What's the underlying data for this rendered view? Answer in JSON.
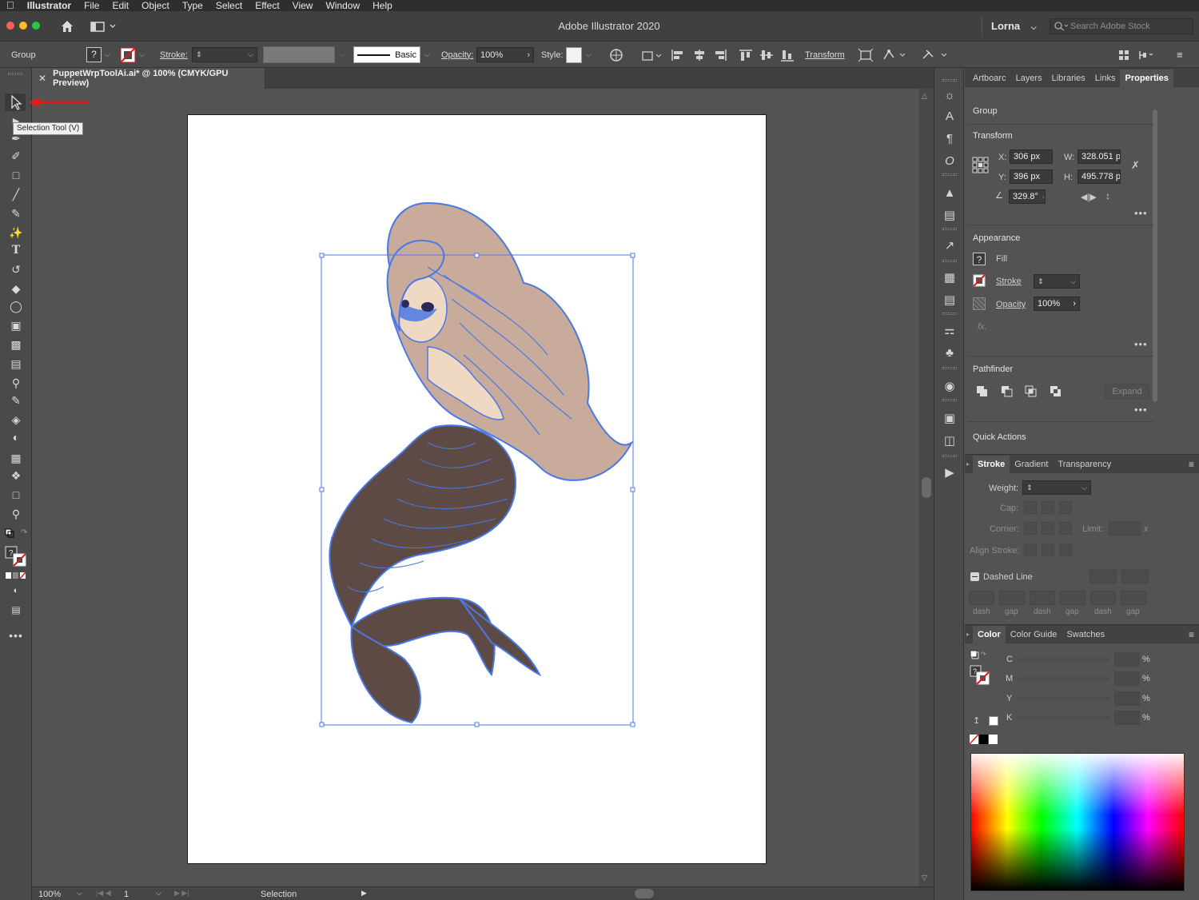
{
  "menubar": {
    "app": "Illustrator",
    "items": [
      "File",
      "Edit",
      "Object",
      "Type",
      "Select",
      "Effect",
      "View",
      "Window",
      "Help"
    ]
  },
  "titlebar": {
    "title": "Adobe Illustrator 2020",
    "user": "Lorna",
    "search_placeholder": "Search Adobe Stock"
  },
  "controlbar": {
    "selection_type": "Group",
    "stroke_label": "Stroke:",
    "brush_label": "Basic",
    "opacity_label": "Opacity:",
    "opacity_value": "100%",
    "style_label": "Style:",
    "transform_label": "Transform"
  },
  "document": {
    "tab_title": "PuppetWrpToolAi.ai* @ 100% (CMYK/GPU Preview)",
    "tooltip": "Selection Tool (V)"
  },
  "statusbar": {
    "zoom": "100%",
    "artboard_number": "1",
    "mode": "Selection"
  },
  "properties_panel": {
    "tabs": [
      "Artboarc",
      "Layers",
      "Libraries",
      "Links",
      "Properties"
    ],
    "active_tab": "Properties",
    "selection_label": "Group",
    "transform": {
      "title": "Transform",
      "x_label": "X:",
      "x_value": "306 px",
      "y_label": "Y:",
      "y_value": "396 px",
      "w_label": "W:",
      "w_value": "328.051 p",
      "h_label": "H:",
      "h_value": "495.778 p",
      "angle_value": "329.8°"
    },
    "appearance": {
      "title": "Appearance",
      "fill_label": "Fill",
      "stroke_label": "Stroke",
      "opacity_label": "Opacity",
      "opacity_value": "100%",
      "fx_label": "fx."
    },
    "pathfinder": {
      "title": "Pathfinder",
      "expand_label": "Expand"
    },
    "quick_actions_title": "Quick Actions"
  },
  "stroke_panel": {
    "tabs": [
      "Stroke",
      "Gradient",
      "Transparency"
    ],
    "active_tab": "Stroke",
    "weight_label": "Weight:",
    "cap_label": "Cap:",
    "corner_label": "Corner:",
    "limit_label": "Limit:",
    "limit_unit": "x",
    "align_label": "Align Stroke:",
    "dashed_label": "Dashed Line",
    "dash_labels": [
      "dash",
      "gap",
      "dash",
      "gap",
      "dash",
      "gap"
    ]
  },
  "color_panel": {
    "tabs": [
      "Color",
      "Color Guide",
      "Swatches"
    ],
    "active_tab": "Color",
    "channels": [
      "C",
      "M",
      "Y",
      "K"
    ],
    "unit": "%"
  },
  "colors": {
    "selection_blue": "#4a78e6",
    "hair": "#c8ab9b",
    "skin": "#f0d9c2",
    "tail": "#5e4a44",
    "annotation_red": "#e21a1a"
  }
}
